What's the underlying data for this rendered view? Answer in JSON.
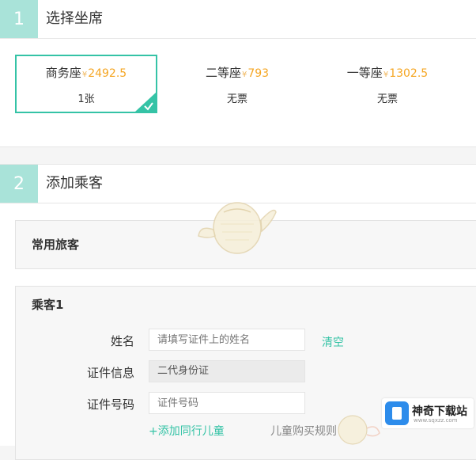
{
  "section1": {
    "number": "1",
    "title": "选择坐席"
  },
  "seats": [
    {
      "name": "商务座",
      "price": "2492.5",
      "currency": "¥",
      "stock": "1张",
      "selected": true
    },
    {
      "name": "二等座",
      "price": "793",
      "currency": "¥",
      "stock": "无票",
      "selected": false
    },
    {
      "name": "一等座",
      "price": "1302.5",
      "currency": "¥",
      "stock": "无票",
      "selected": false
    }
  ],
  "section2": {
    "number": "2",
    "title": "添加乘客"
  },
  "common_travelers": {
    "title": "常用旅客"
  },
  "passenger": {
    "title": "乘客1",
    "name_label": "姓名",
    "name_placeholder": "请填写证件上的姓名",
    "clear_label": "清空",
    "id_type_label": "证件信息",
    "id_type_value": "二代身份证",
    "id_number_label": "证件号码",
    "id_number_placeholder": "证件号码",
    "add_child_label": "+添加同行儿童",
    "child_rule_label": "儿童购买规则"
  },
  "watermark": {
    "site_name": "神奇下载站",
    "site_url": "www.sqxzz.com"
  },
  "colors": {
    "accent": "#35c3a6",
    "step_badge": "#a9e3d9",
    "price": "#f5a623"
  },
  "icons": [
    "check-icon",
    "mascot-watermark-icon",
    "site-logo-icon"
  ]
}
